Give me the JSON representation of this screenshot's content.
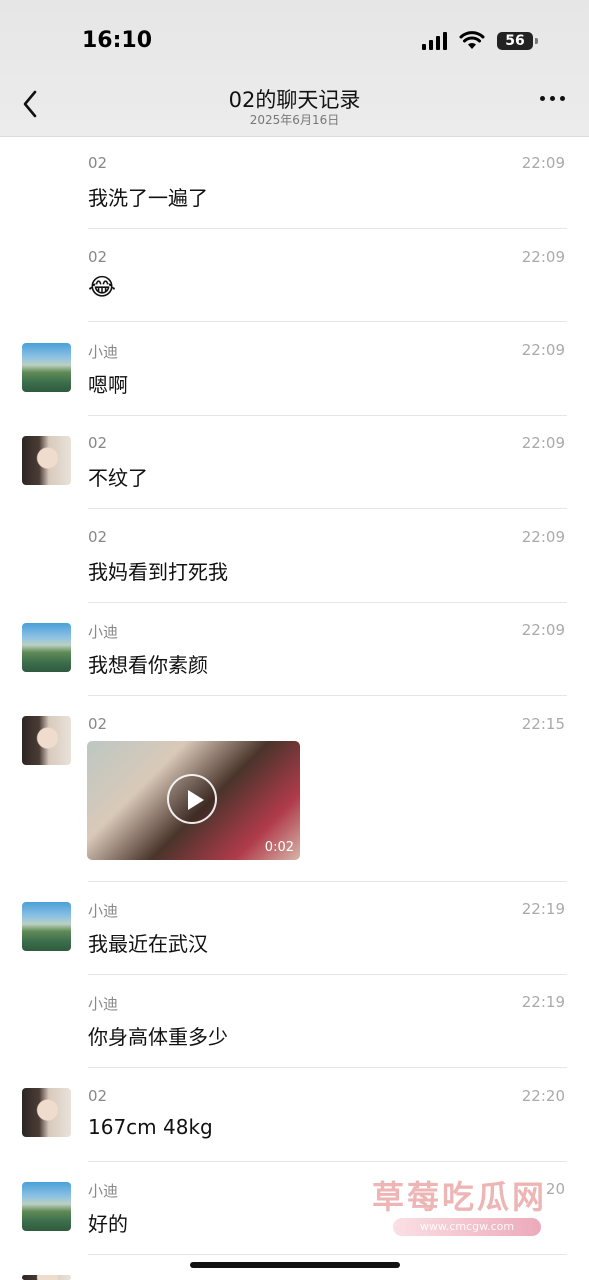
{
  "status_bar": {
    "time": "16:10",
    "battery": "56"
  },
  "nav": {
    "title": "02的聊天记录",
    "subtitle": "2025年6月16日"
  },
  "messages": [
    {
      "name": "02",
      "time": "22:09",
      "text": "我洗了一遍了"
    },
    {
      "name": "02",
      "time": "22:09",
      "text": "😂"
    },
    {
      "name": "小迪",
      "time": "22:09",
      "text": "嗯啊"
    },
    {
      "name": "02",
      "time": "22:09",
      "text": "不纹了"
    },
    {
      "name": "02",
      "time": "22:09",
      "text": "我妈看到打死我"
    },
    {
      "name": "小迪",
      "time": "22:09",
      "text": "我想看你素颜"
    },
    {
      "name": "02",
      "time": "22:15",
      "video_duration": "0:02"
    },
    {
      "name": "小迪",
      "time": "22:19",
      "text": "我最近在武汉"
    },
    {
      "name": "小迪",
      "time": "22:19",
      "text": "你身高体重多少"
    },
    {
      "name": "02",
      "time": "22:20",
      "text": "167cm 48kg"
    },
    {
      "name": "小迪",
      "time": "20",
      "text": "好的"
    }
  ],
  "watermark": {
    "title": "草莓吃瓜网",
    "url": "www.cmcgw.com"
  },
  "colors": {
    "header_bg": "#e8e8e8",
    "name_gray": "#888888",
    "time_gray": "#aaaaaa"
  }
}
